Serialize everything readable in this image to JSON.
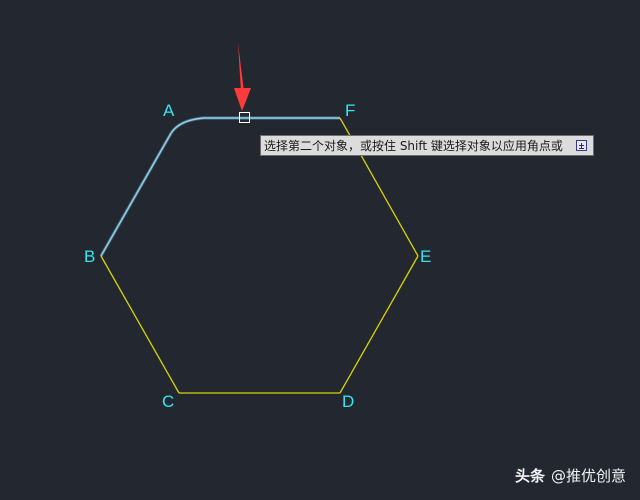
{
  "drawing": {
    "vertices": {
      "a": "A",
      "b": "B",
      "c": "C",
      "d": "D",
      "e": "E",
      "f": "F"
    },
    "colors": {
      "background": "#232830",
      "hexagon_line": "#d9d400",
      "highlight_line": "#8fd3f0",
      "vertex_label": "#33e6f0",
      "arrow": "#ff3a3a"
    }
  },
  "prompt": {
    "text": "选择第二个对象，或按住 Shift 键选择对象以应用角点或",
    "expand_icon": "expand-icon"
  },
  "watermark": {
    "brand": "头条",
    "handle": "@推优创意"
  }
}
